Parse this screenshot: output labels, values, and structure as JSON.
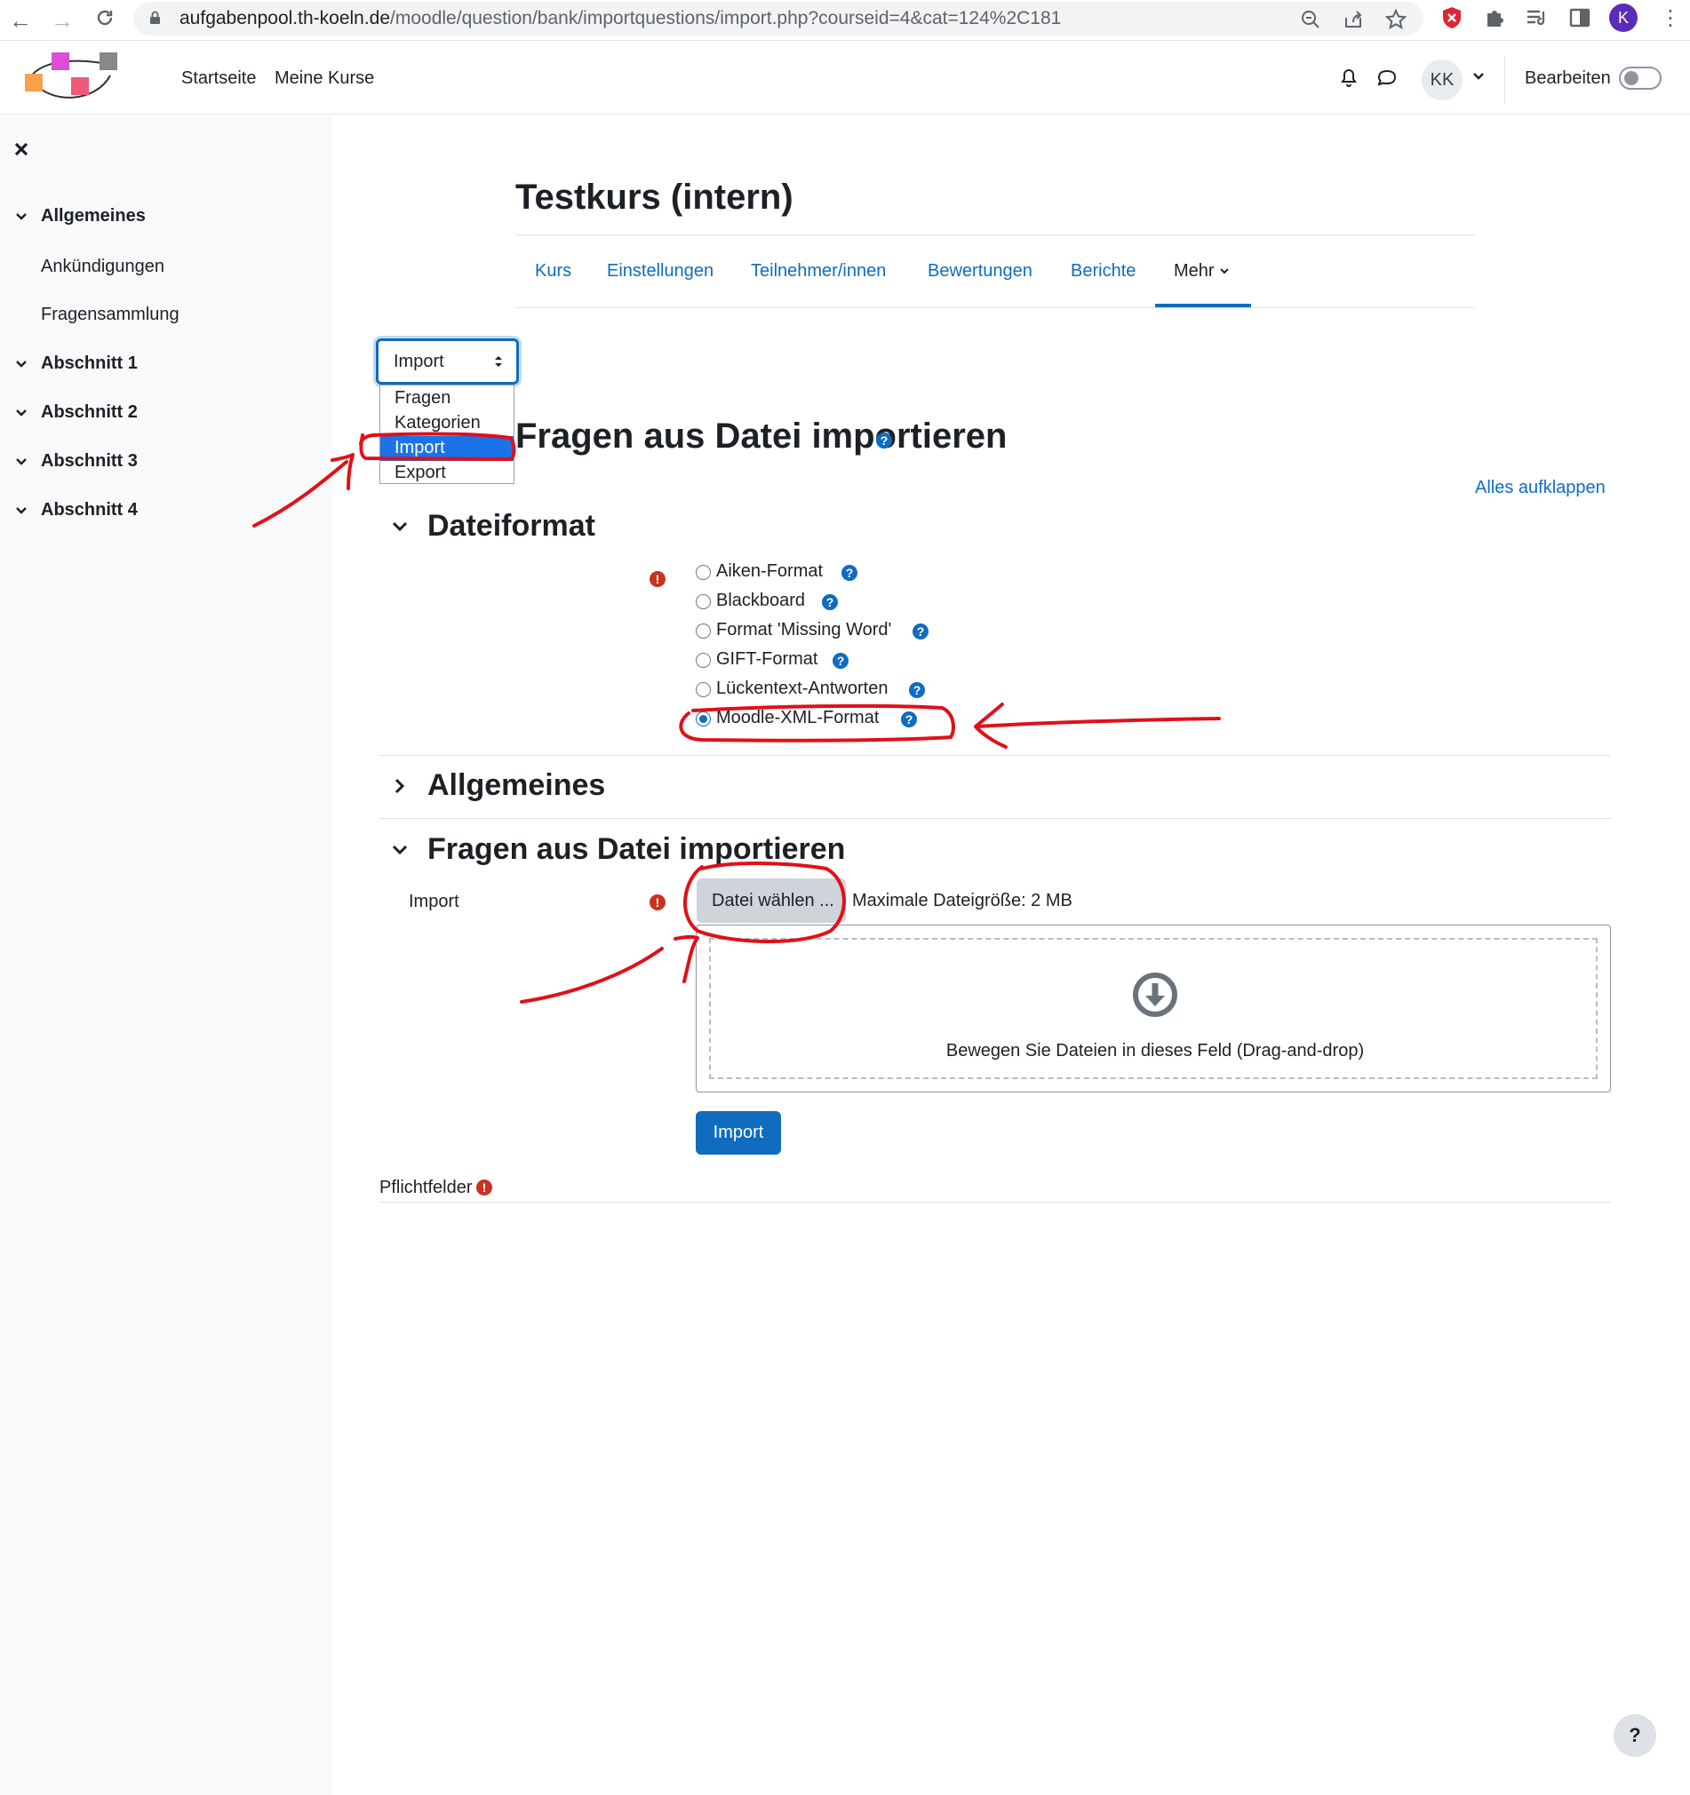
{
  "browser": {
    "url_host": "aufgabenpool.th-koeln.de",
    "url_path": "/moodle/question/bank/importquestions/import.php?courseid=4&cat=124%2C181",
    "profile_initial": "K"
  },
  "navbar": {
    "links": [
      "Startseite",
      "Meine Kurse"
    ],
    "avatar_initials": "KK",
    "edit_mode_label": "Bearbeiten",
    "edit_mode_on": false
  },
  "drawer": {
    "sections": [
      {
        "label": "Allgemeines",
        "items": [
          "Ankündigungen",
          "Fragensammlung"
        ]
      },
      {
        "label": "Abschnitt 1",
        "items": []
      },
      {
        "label": "Abschnitt 2",
        "items": []
      },
      {
        "label": "Abschnitt 3",
        "items": []
      },
      {
        "label": "Abschnitt 4",
        "items": []
      }
    ]
  },
  "course": {
    "title": "Testkurs (intern)",
    "tabs": [
      "Kurs",
      "Einstellungen",
      "Teilnehmer/innen",
      "Bewertungen",
      "Berichte"
    ],
    "more_label": "Mehr"
  },
  "action_select": {
    "value": "Import",
    "options": [
      "Fragen",
      "Kategorien",
      "Import",
      "Export"
    ],
    "highlighted": "Import"
  },
  "page": {
    "heading": "Fragen aus Datei importieren",
    "expand_all": "Alles aufklappen",
    "help_glyph": "?",
    "required_glyph": "!"
  },
  "file_format": {
    "legend": "Dateiformat",
    "options": [
      "Aiken-Format",
      "Blackboard",
      "Format 'Missing Word'",
      "GIFT-Format",
      "Lückentext-Antworten",
      "Moodle-XML-Format"
    ],
    "selected": "Moodle-XML-Format"
  },
  "general": {
    "legend": "Allgemeines"
  },
  "import_section": {
    "legend": "Fragen aus Datei importieren",
    "field_label": "Import",
    "choose_file": "Datei wählen ...",
    "max_size": "Maximale Dateigröße: 2 MB",
    "dropzone_text": "Bewegen Sie Dateien in dieses Feld (Drag-and-drop)",
    "submit": "Import",
    "required_note": "Pflichtfelder"
  },
  "floating_help": "?",
  "colors": {
    "brand": "#0f6cbf",
    "required": "#ca3120",
    "annotation": "#e0101a",
    "drawer_bg": "#f8f9fa"
  }
}
